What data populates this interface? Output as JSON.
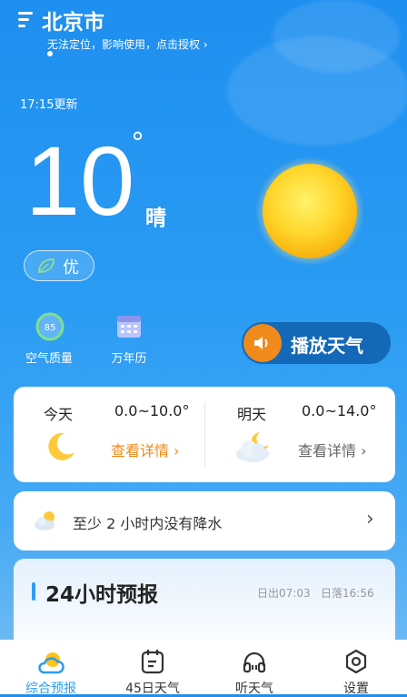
{
  "header": {
    "city": "北京市",
    "location_notice": "无法定位，影响使用，点击授权 ›",
    "updated": "17:15更新"
  },
  "current": {
    "temperature": "10",
    "degree": "°",
    "condition": "晴",
    "aqi_label": "优",
    "aqi_value": "85"
  },
  "shortcuts": {
    "air_quality": "空气质量",
    "calendar": "万年历",
    "play_weather": "播放天气"
  },
  "forecast": {
    "today": {
      "label": "今天",
      "range": "0.0~10.0°",
      "details": "查看详情 ›"
    },
    "tomorrow": {
      "label": "明天",
      "range": "0.0~14.0°",
      "details": "查看详情 ›"
    }
  },
  "precip": {
    "text": "至少 2 小时内没有降水",
    "chevron": "›"
  },
  "hourly": {
    "title": "24小时预报",
    "sunrise": "日出07:03",
    "sunset": "日落16:56"
  },
  "nav": {
    "items": [
      {
        "label": "综合预报",
        "active": true
      },
      {
        "label": "45日天气",
        "active": false
      },
      {
        "label": "听天气",
        "active": false
      },
      {
        "label": "设置",
        "active": false
      }
    ]
  },
  "colors": {
    "accent": "#2d9cf2",
    "orange": "#f08a1a",
    "sun": "#ffc21a",
    "play_button": "#1468b8"
  }
}
